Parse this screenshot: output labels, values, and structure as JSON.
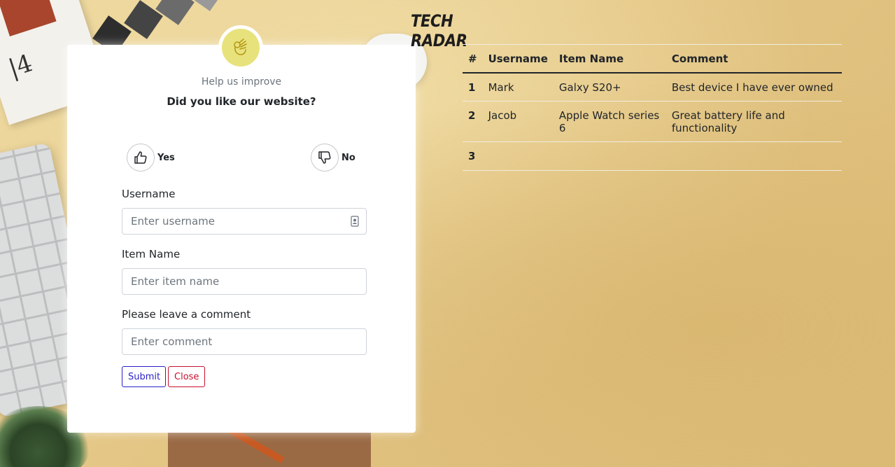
{
  "brand": {
    "title": "TECH RADAR"
  },
  "feedback": {
    "help_text": "Help us improve",
    "question": "Did you like our website?",
    "yes_label": "Yes",
    "no_label": "No",
    "username": {
      "label": "Username",
      "placeholder": "Enter username"
    },
    "item_name": {
      "label": "Item Name",
      "placeholder": "Enter item name"
    },
    "comment": {
      "label": "Please leave a comment",
      "placeholder": "Enter comment"
    },
    "submit_label": "Submit",
    "close_label": "Close"
  },
  "table": {
    "headers": [
      "#",
      "Username",
      "Item Name",
      "Comment"
    ],
    "rows": [
      {
        "num": "1",
        "username": "Mark",
        "item": "Galxy S20+",
        "comment": "Best device I have ever owned"
      },
      {
        "num": "2",
        "username": "Jacob",
        "item": "Apple Watch series 6",
        "comment": "Great battery life and functionality"
      },
      {
        "num": "3",
        "username": "",
        "item": "",
        "comment": ""
      }
    ]
  },
  "colors": {
    "submit": "#2b1fc9",
    "close": "#c8102e",
    "emoji_bg": "#e8e27c",
    "background": "#e3c584"
  },
  "icons": {
    "badge": "ok-hand-icon",
    "yes": "thumbs-up-icon",
    "no": "thumbs-down-icon",
    "username_field": "contact-card-icon"
  }
}
